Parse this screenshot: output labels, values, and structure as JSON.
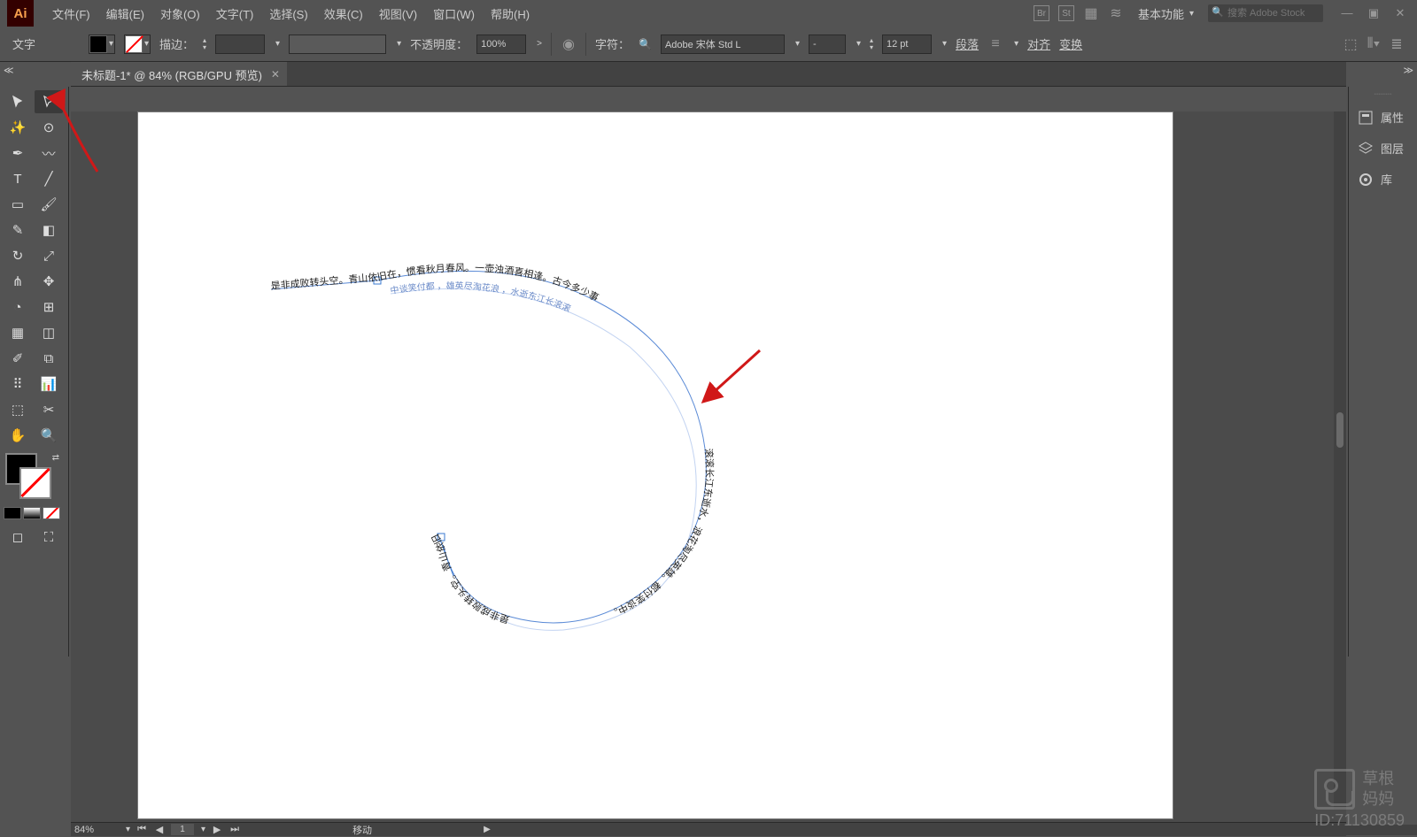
{
  "menu": {
    "items": [
      "文件(F)",
      "编辑(E)",
      "对象(O)",
      "文字(T)",
      "选择(S)",
      "效果(C)",
      "视图(V)",
      "窗口(W)",
      "帮助(H)"
    ],
    "workspace": "基本功能",
    "search_placeholder": "搜索 Adobe Stock"
  },
  "options": {
    "tool_label": "文字",
    "stroke_label": "描边：",
    "opacity_label": "不透明度：",
    "opacity_value": "100%",
    "char_label": "字符：",
    "font_name": "Adobe 宋体 Std L",
    "font_style": "-",
    "font_size": "12 pt",
    "para_label": "段落",
    "align_label": "对齐",
    "transform_label": "变换"
  },
  "tab": {
    "title": "未标题-1* @ 84% (RGB/GPU 预览)"
  },
  "right_panels": [
    "属性",
    "图层",
    "库"
  ],
  "status": {
    "zoom": "84%",
    "page": "1",
    "tool_hint": "移动"
  },
  "watermark": {
    "line1": "草根妈妈",
    "line2": "ID:71130859"
  },
  "canvas": {
    "path_text_outer": "是非成败转头空。青山依旧在，惯看秋月春风。一壶浊酒喜相逢。古今多少事",
    "path_text_right": "滚滚长江东逝水，浪花淘尽英雄。都付笑谈中。",
    "path_text_bottom": "是非成败转头空。青山依旧在，惯看秋月春风",
    "path_text_inner": "中谈笑付都 ，雄英尽淘花浪 ，水逝东江长滚滚"
  }
}
